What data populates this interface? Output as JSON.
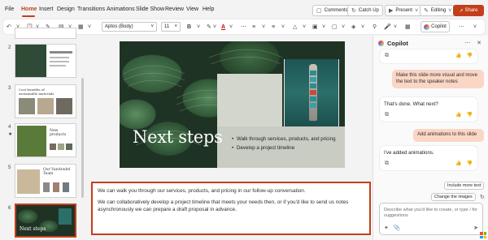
{
  "ribbon": {
    "tabs": [
      "File",
      "Home",
      "Insert",
      "Design",
      "Transitions",
      "Animations",
      "Slide Show",
      "Review",
      "View",
      "Help"
    ],
    "comments_label": "Comments",
    "catchup_label": "Catch Up",
    "present_label": "Present",
    "editing_label": "Editing",
    "share_label": "Share"
  },
  "toolbar": {
    "font_name": "Aptos (Body)",
    "font_size": "11",
    "copilot_label": "Copilot"
  },
  "thumbnails": {
    "numbers": [
      "2",
      "3",
      "4",
      "5",
      "6"
    ],
    "t3_title": "Cost benefits of sustainable materials",
    "t4_title": "New products",
    "t5_title": "Our VanArsdel Team",
    "t6_title": "Next steps"
  },
  "slide": {
    "title": "Next steps",
    "bullets": [
      "Walk through services, products, and pricing",
      "Develop a project timeline"
    ]
  },
  "notes": {
    "para1": "We can walk you through our services, products, and pricing in our follow-up conversation.",
    "para2": "We can collaboratively develop a project timeline that meets your needs then, or if you'd like to send us notes asynchronously we can prepare a draft proposal in advance."
  },
  "copilot": {
    "title": "Copilot",
    "user_msg1": "Make this slide more visual and move the text to the speaker notes",
    "bot_msg1": "That's done. What next?",
    "user_msg2": "Add animations to this slide",
    "bot_msg2": "I've added animations.",
    "suggestion1": "Include more text",
    "suggestion2": "Change the images",
    "composer_placeholder": "Describe what you'd like to create, or type / for suggestions"
  },
  "colors": {
    "accent": "#c43e1c",
    "user_bubble": "#f9d6c6"
  }
}
